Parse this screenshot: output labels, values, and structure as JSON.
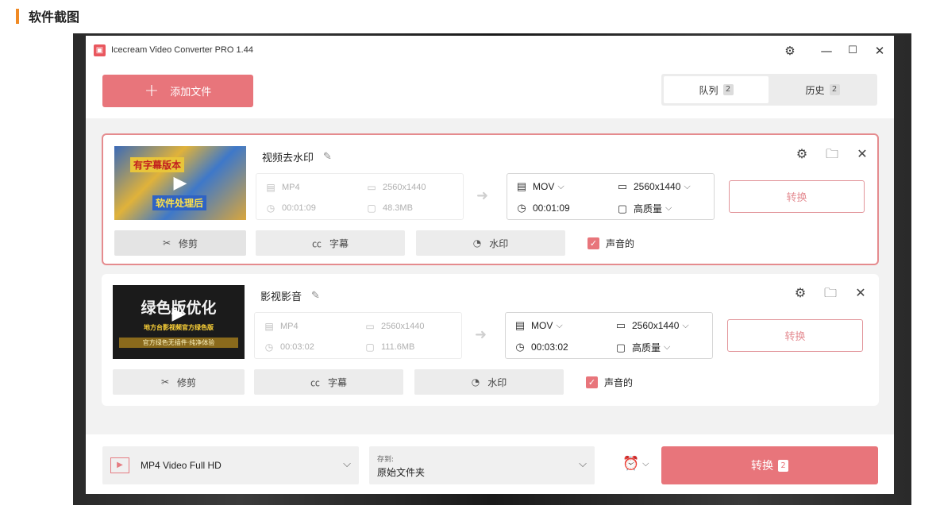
{
  "section": {
    "title": "软件截图"
  },
  "window": {
    "title": "Icecream Video Converter PRO 1.44"
  },
  "toolbar": {
    "add_file_label": "添加文件"
  },
  "tabs": [
    {
      "label": "队列",
      "count": "2",
      "active": true
    },
    {
      "label": "历史",
      "count": "2",
      "active": false
    }
  ],
  "items": [
    {
      "title": "视频去水印",
      "thumb_text_top": "有字幕版本",
      "thumb_text_bottom": "软件处理后",
      "input": {
        "format": "MP4",
        "resolution": "2560x1440",
        "duration": "00:01:09",
        "size": "48.3MB"
      },
      "output": {
        "format": "MOV",
        "resolution": "2560x1440",
        "duration": "00:01:09",
        "quality": "高质量"
      },
      "convert_label": "转换",
      "actions": {
        "trim": "修剪",
        "subtitles": "字幕",
        "watermark": "水印"
      },
      "sound_label": "声音的",
      "sound_checked": true,
      "selected": true
    },
    {
      "title": "影视影音",
      "thumb_text_top": "绿色版优化",
      "thumb_text_mid": "地方台影视频官方绿色版",
      "thumb_text_bottom": "官方绿色无插件·纯净体验",
      "input": {
        "format": "MP4",
        "resolution": "2560x1440",
        "duration": "00:03:02",
        "size": "111.6MB"
      },
      "output": {
        "format": "MOV",
        "resolution": "2560x1440",
        "duration": "00:03:02",
        "quality": "高质量"
      },
      "convert_label": "转换",
      "actions": {
        "trim": "修剪",
        "subtitles": "字幕",
        "watermark": "水印"
      },
      "sound_label": "声音的",
      "sound_checked": true,
      "selected": false
    }
  ],
  "bottom": {
    "preset_label": "MP4 Video Full HD",
    "save_to_label": "存到:",
    "save_to_value": "原始文件夹",
    "convert_all_label": "转换",
    "convert_all_count": "2"
  },
  "colors": {
    "accent": "#e8757b",
    "section_bar": "#f08a24"
  }
}
